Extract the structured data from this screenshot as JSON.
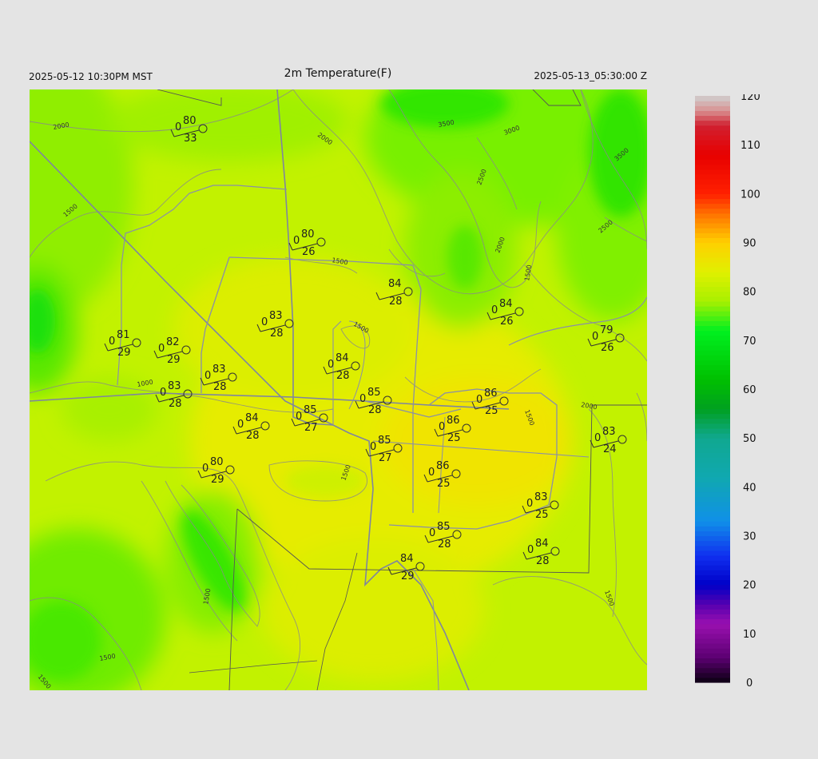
{
  "header": {
    "left_time": "2025-05-12 10:30PM MST",
    "title": "2m Temperature(F)",
    "right_time": "2025-05-13_05:30:00 Z"
  },
  "colorbar": {
    "min": 0,
    "max": 120,
    "tick_labels": [
      "120",
      "110",
      "100",
      "90",
      "80",
      "70",
      "60",
      "50",
      "40",
      "30",
      "20",
      "10",
      "0"
    ],
    "color_stops": [
      {
        "v": 0,
        "c": "#0a0010"
      },
      {
        "v": 5,
        "c": "#5a0070"
      },
      {
        "v": 12,
        "c": "#9a10b0"
      },
      {
        "v": 16,
        "c": "#5500b0"
      },
      {
        "v": 20,
        "c": "#0000c8"
      },
      {
        "v": 26,
        "c": "#1030f0"
      },
      {
        "v": 33,
        "c": "#1090e8"
      },
      {
        "v": 42,
        "c": "#10a8b0"
      },
      {
        "v": 50,
        "c": "#10a890"
      },
      {
        "v": 56,
        "c": "#00a020"
      },
      {
        "v": 62,
        "c": "#00c000"
      },
      {
        "v": 72,
        "c": "#00f020"
      },
      {
        "v": 78,
        "c": "#a8f000"
      },
      {
        "v": 84,
        "c": "#e0f000"
      },
      {
        "v": 90,
        "c": "#ffd000"
      },
      {
        "v": 96,
        "c": "#ff7000"
      },
      {
        "v": 100,
        "c": "#ff2000"
      },
      {
        "v": 108,
        "c": "#e80000"
      },
      {
        "v": 114,
        "c": "#d02030"
      },
      {
        "v": 117,
        "c": "#d89090"
      },
      {
        "v": 120,
        "c": "#d0d0d0"
      }
    ]
  },
  "contour_labels": [
    "2000",
    "2000",
    "1500",
    "1500",
    "1500",
    "1000",
    "3500",
    "3000",
    "2500",
    "2000",
    "1500",
    "2500",
    "3500",
    "2000",
    "1500",
    "1500",
    "1500",
    "1500",
    "1500",
    "1500"
  ],
  "stations": [
    {
      "temp": "80",
      "dew": "33",
      "left": "0"
    },
    {
      "temp": "80",
      "dew": "26",
      "left": "0"
    },
    {
      "temp": "84",
      "dew": "28",
      "left": ""
    },
    {
      "temp": "84",
      "dew": "26",
      "left": "0"
    },
    {
      "temp": "79",
      "dew": "26",
      "left": "0"
    },
    {
      "temp": "81",
      "dew": "29",
      "left": "0"
    },
    {
      "temp": "82",
      "dew": "29",
      "left": "0"
    },
    {
      "temp": "83",
      "dew": "28",
      "left": "0"
    },
    {
      "temp": "83",
      "dew": "28",
      "left": "0"
    },
    {
      "temp": "84",
      "dew": "28",
      "left": "0"
    },
    {
      "temp": "83",
      "dew": "28",
      "left": "0"
    },
    {
      "temp": "85",
      "dew": "28",
      "left": "0"
    },
    {
      "temp": "86",
      "dew": "25",
      "left": "0"
    },
    {
      "temp": "85",
      "dew": "27",
      "left": "0"
    },
    {
      "temp": "84",
      "dew": "28",
      "left": "0"
    },
    {
      "temp": "86",
      "dew": "25",
      "left": "0"
    },
    {
      "temp": "85",
      "dew": "27",
      "left": "0"
    },
    {
      "temp": "83",
      "dew": "24",
      "left": "0"
    },
    {
      "temp": "80",
      "dew": "29",
      "left": "0"
    },
    {
      "temp": "86",
      "dew": "25",
      "left": "0"
    },
    {
      "temp": "83",
      "dew": "25",
      "left": "0"
    },
    {
      "temp": "85",
      "dew": "28",
      "left": "0"
    },
    {
      "temp": "84",
      "dew": "28",
      "left": "0"
    },
    {
      "temp": "84",
      "dew": "29",
      "left": ""
    }
  ]
}
